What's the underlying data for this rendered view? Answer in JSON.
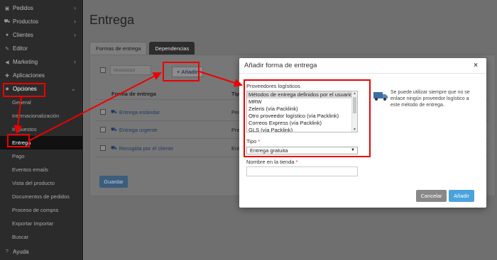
{
  "sidebar": {
    "items": [
      {
        "icon": "shopping-bag-icon",
        "label": "Pedidos",
        "chevron": "›"
      },
      {
        "icon": "cart-icon",
        "label": "Productos",
        "chevron": "›"
      },
      {
        "icon": "users-icon",
        "label": "Clientes",
        "chevron": "›"
      },
      {
        "icon": "pencil-icon",
        "label": "Editor"
      },
      {
        "icon": "megaphone-icon",
        "label": "Marketing",
        "chevron": "›"
      },
      {
        "icon": "puzzle-icon",
        "label": "Aplicaciones"
      },
      {
        "icon": "gear-icon",
        "label": "Opciones",
        "chevron": "⌄"
      }
    ],
    "sub_items": [
      "General",
      "Internacionalización",
      "Impuestos",
      "Entrega",
      "Pago",
      "Eventos emails",
      "Vista del producto",
      "Documentos de pedidos",
      "Proceso de compra",
      "Exportar Importar",
      "Buscar"
    ],
    "help": {
      "icon": "question-icon",
      "label": "Ayuda"
    }
  },
  "page": {
    "title": "Entrega",
    "tabs": [
      "Formas de entrega",
      "Dependencias"
    ],
    "toolbar": {
      "bulk_placeholder": "Modalidad",
      "add_label": "+ Añadir"
    },
    "table": {
      "headers": [
        "Forma de entrega",
        "Tipo"
      ],
      "rows": [
        {
          "name": "Entrega estándar",
          "type": "Peso"
        },
        {
          "name": "Entrega urgente",
          "type": "Precio"
        },
        {
          "name": "Recogida por el cliente",
          "type": "Entr"
        }
      ]
    },
    "save_label": "Guardar"
  },
  "modal": {
    "title": "Añadir forma de entrega",
    "close": "×",
    "providers_label": "Proveedores logísticos",
    "providers": [
      "Métodos de entrega definidos por el usuario",
      "MRW",
      "Zeleris (vía Packlink)",
      "Otro proveedor logístico (vía Packlink)",
      "Correos Express (vía Packlink)",
      "GLS (vía Packlink)"
    ],
    "type_label": "Tipo",
    "type_value": "Entrega gratuita",
    "store_name_label": "Nombre en la tienda",
    "required_mark": "*",
    "info_text": "Se puede utilizar siempre que no se enlace ningún proveedor logístico a este método de entrega.",
    "cancel_label": "Cancelar",
    "add_label": "Añadir"
  },
  "colors": {
    "annotation": "#e00000",
    "primary": "#4aa3df",
    "sidebar": "#2b2b2b"
  }
}
